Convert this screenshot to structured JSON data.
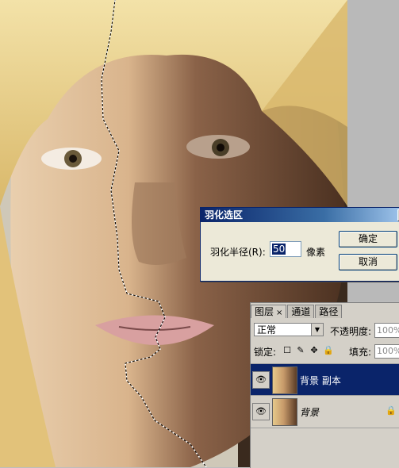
{
  "feather_dialog": {
    "title": "羽化选区",
    "close_glyph": "×",
    "radius_label": "羽化半径(R):",
    "radius_value": "50",
    "unit": "像素",
    "ok_label": "确定",
    "cancel_label": "取消"
  },
  "layers_panel": {
    "tabs": [
      {
        "label": "图层",
        "active": true,
        "close": "×"
      },
      {
        "label": "通道",
        "active": false
      },
      {
        "label": "路径",
        "active": false
      }
    ],
    "blend_mode": "正常",
    "opacity_label": "不透明度:",
    "opacity_value": "100%",
    "lock_label": "锁定:",
    "fill_label": "填充:",
    "fill_value": "100%",
    "layers": [
      {
        "name": "背景 副本",
        "selected": true,
        "visible": true
      },
      {
        "name": "背景",
        "selected": false,
        "visible": true,
        "locked": true
      }
    ]
  },
  "colors": {
    "selection_blue": "#0a246a",
    "panel_gray": "#d4d0c8"
  }
}
